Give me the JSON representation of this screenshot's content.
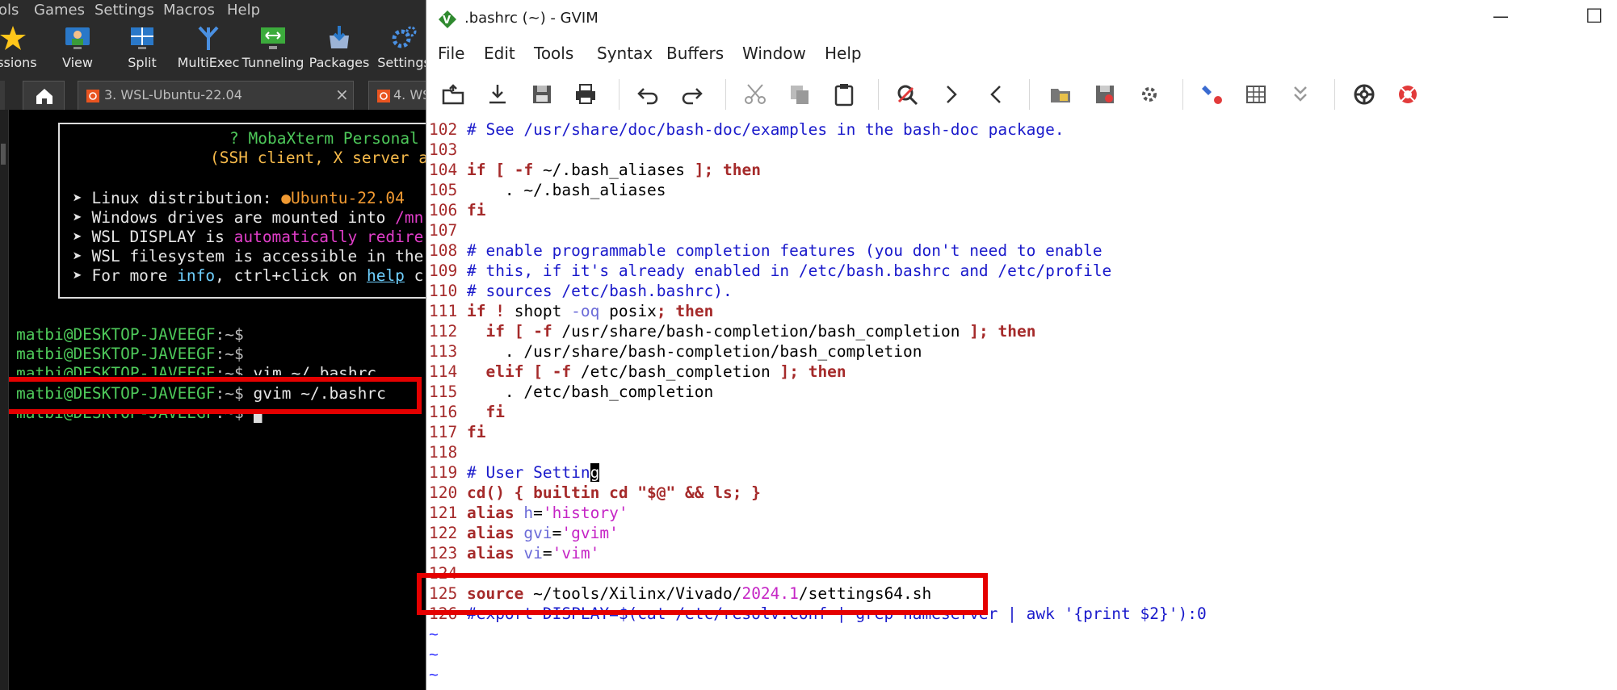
{
  "moba": {
    "menu": [
      "ols",
      "Games",
      "Settings",
      "Macros",
      "Help"
    ],
    "toolbar": [
      "essions",
      "View",
      "Split",
      "MultiExec",
      "Tunneling",
      "Packages",
      "Settings"
    ],
    "tabs": [
      {
        "label": "3. WSL-Ubuntu-22.04",
        "close": "×"
      },
      {
        "label": "4. WS"
      }
    ],
    "motd": {
      "title": "? MobaXterm Personal",
      "subtitle": "(SSH client, X server a",
      "lines": [
        {
          "a": "➤ Linux distribution: ",
          "b": "●Ubuntu-22.04"
        },
        {
          "a": "➤ Windows drives are mounted into ",
          "b": "/mn"
        },
        {
          "a": "➤ WSL DISPLAY is ",
          "b": "automatically redire"
        },
        {
          "a": "➤ WSL filesystem is accessible in ",
          "b": "the"
        },
        {
          "a": "➤ For more ",
          "b": "info",
          "c": ", ctrl+click on ",
          "d": "help",
          "e": " c"
        }
      ]
    },
    "prompt_user": "matbi@DESKTOP-JAVEEGF",
    "prompt_path": ":~$",
    "commands": [
      "",
      "",
      " vim ~/.bashrc",
      " gvim ~/.bashrc",
      " "
    ]
  },
  "gvim": {
    "title": ".bashrc (~) - GVIM",
    "menu": [
      "File",
      "Edit",
      "Tools",
      "Syntax",
      "Buffers",
      "Window",
      "Help"
    ],
    "minimize": "—",
    "maximize": "☐",
    "lines": [
      {
        "n": "102",
        "t": " # See /usr/share/doc/bash-doc/examples in the bash-doc package."
      },
      {
        "n": "103",
        "t": ""
      },
      {
        "n": "104",
        "t": " if [ -f ~/.bash_aliases ]; then"
      },
      {
        "n": "105",
        "t": "     . ~/.bash_aliases"
      },
      {
        "n": "106",
        "t": " fi"
      },
      {
        "n": "107",
        "t": ""
      },
      {
        "n": "108",
        "t": " # enable programmable completion features (you don't need to enable"
      },
      {
        "n": "109",
        "t": " # this, if it's already enabled in /etc/bash.bashrc and /etc/profile"
      },
      {
        "n": "110",
        "t": " # sources /etc/bash.bashrc)."
      },
      {
        "n": "111",
        "t": " if ! shopt -oq posix; then"
      },
      {
        "n": "112",
        "t": "   if [ -f /usr/share/bash-completion/bash_completion ]; then"
      },
      {
        "n": "113",
        "t": "     . /usr/share/bash-completion/bash_completion"
      },
      {
        "n": "114",
        "t": "   elif [ -f /etc/bash_completion ]; then"
      },
      {
        "n": "115",
        "t": "     . /etc/bash_completion"
      },
      {
        "n": "116",
        "t": "   fi"
      },
      {
        "n": "117",
        "t": " fi"
      },
      {
        "n": "118",
        "t": ""
      },
      {
        "n": "119",
        "t": " # User Setting"
      },
      {
        "n": "120",
        "t": " cd() { builtin cd \"$@\" && ls; }"
      },
      {
        "n": "121",
        "t": " alias h='history'"
      },
      {
        "n": "122",
        "t": " alias gvi='gvim'"
      },
      {
        "n": "123",
        "t": " alias vi='vim'"
      },
      {
        "n": "124",
        "t": ""
      },
      {
        "n": "125",
        "t": " source ~/tools/Xilinx/Vivado/2024.1/settings64.sh"
      },
      {
        "n": "126",
        "t": " #export DISPLAY=$(cat /etc/resolv.conf | grep nameserver | awk '{print $2}'):0"
      }
    ],
    "tildes": [
      "~",
      "~",
      "~"
    ]
  },
  "colors": {
    "highlight_box": "#e50000",
    "prompt_green": "#4ec95a",
    "vim_comment": "#1a1acb",
    "vim_keyword": "#a52a2a",
    "vim_string": "#c525c5"
  }
}
